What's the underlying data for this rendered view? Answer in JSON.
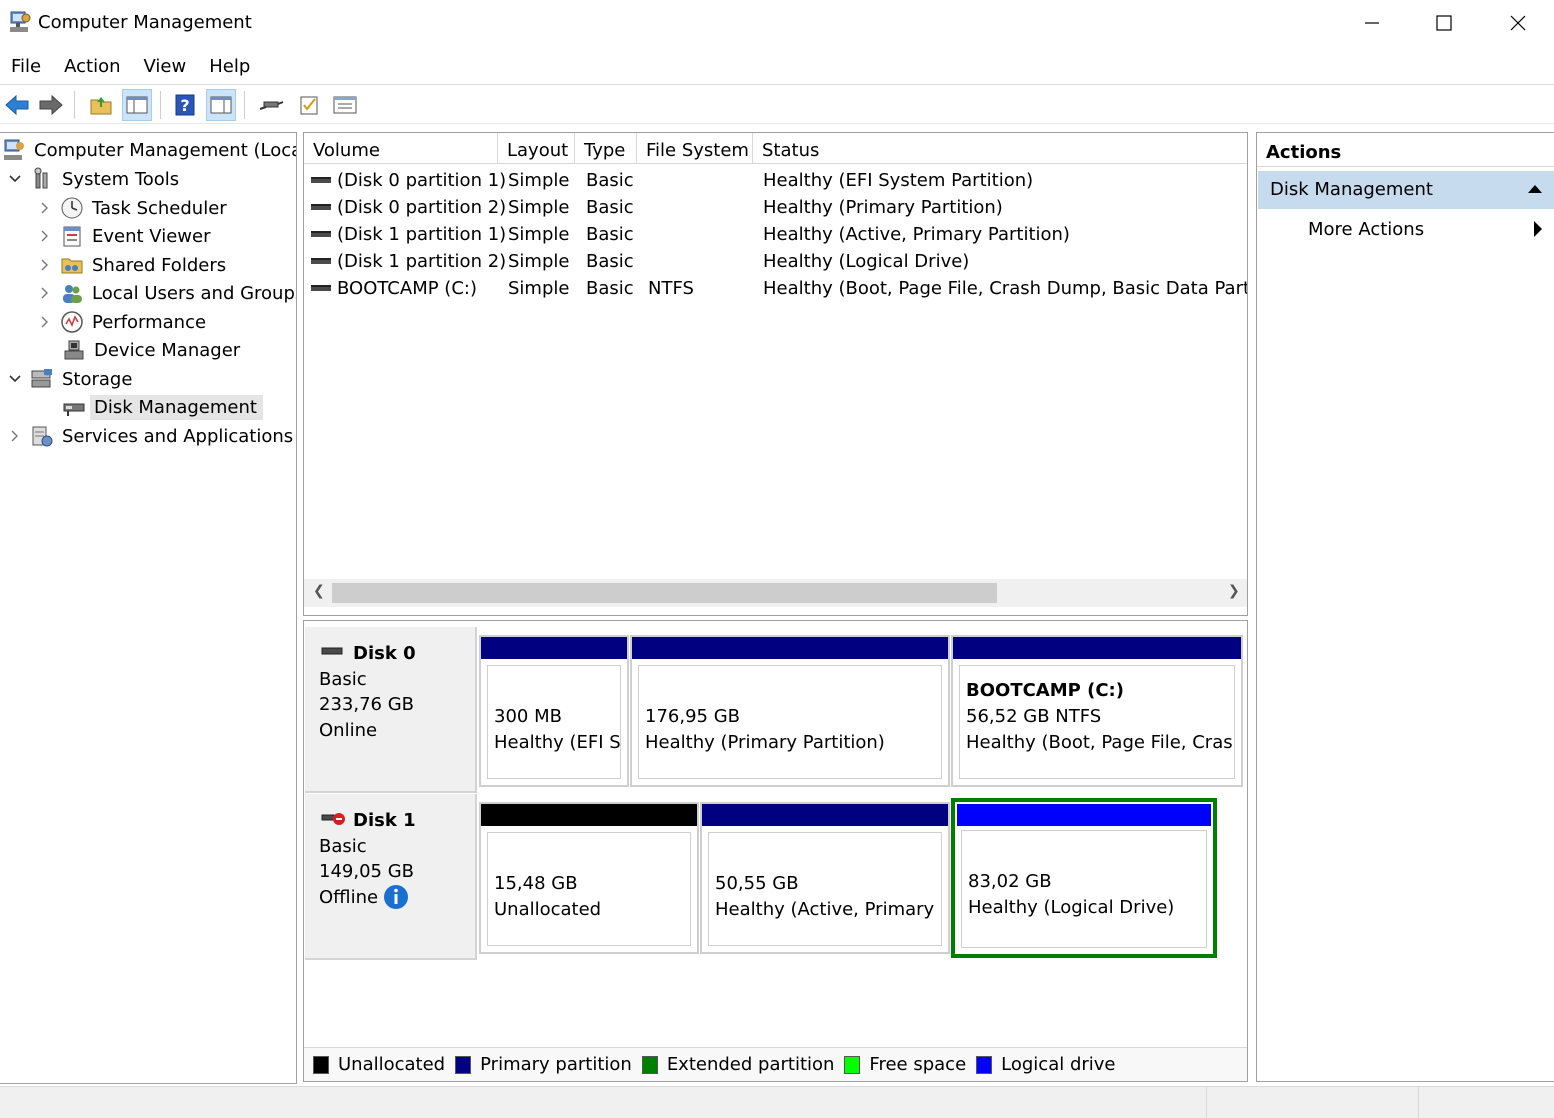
{
  "window": {
    "title": "Computer Management"
  },
  "menu": [
    "File",
    "Action",
    "View",
    "Help"
  ],
  "toolbar": {
    "icons": [
      "back-arrow-icon",
      "forward-arrow-icon",
      "up-folder-icon",
      "show-hide-tree-icon",
      "help-icon",
      "show-hide-action-icon",
      "connect-icon",
      "checklist-icon",
      "properties-icon"
    ]
  },
  "tree": {
    "root": "Computer Management (Local)",
    "system_tools": "System Tools",
    "task_scheduler": "Task Scheduler",
    "event_viewer": "Event Viewer",
    "shared_folders": "Shared Folders",
    "local_users": "Local Users and Groups",
    "performance": "Performance",
    "device_manager": "Device Manager",
    "storage": "Storage",
    "disk_management": "Disk Management",
    "services_apps": "Services and Applications"
  },
  "volumes": {
    "columns": [
      "Volume",
      "Layout",
      "Type",
      "File System",
      "Status"
    ],
    "rows": [
      {
        "volume": "(Disk 0 partition 1)",
        "layout": "Simple",
        "type": "Basic",
        "fs": "",
        "status": "Healthy (EFI System Partition)"
      },
      {
        "volume": "(Disk 0 partition 2)",
        "layout": "Simple",
        "type": "Basic",
        "fs": "",
        "status": "Healthy (Primary Partition)"
      },
      {
        "volume": "(Disk 1 partition 1)",
        "layout": "Simple",
        "type": "Basic",
        "fs": "",
        "status": "Healthy (Active, Primary Partition)"
      },
      {
        "volume": "(Disk 1 partition 2)",
        "layout": "Simple",
        "type": "Basic",
        "fs": "",
        "status": "Healthy (Logical Drive)"
      },
      {
        "volume": "BOOTCAMP (C:)",
        "layout": "Simple",
        "type": "Basic",
        "fs": "NTFS",
        "status": "Healthy (Boot, Page File, Crash Dump, Basic Data Partitior"
      }
    ]
  },
  "disks": {
    "disk0": {
      "name": "Disk 0",
      "type": "Basic",
      "size": "233,76 GB",
      "state": "Online",
      "partitions": [
        {
          "title": "",
          "line1": "300 MB",
          "line2": "Healthy (EFI Sy"
        },
        {
          "title": "",
          "line1": "176,95 GB",
          "line2": "Healthy (Primary Partition)"
        },
        {
          "title": "BOOTCAMP  (C:)",
          "line1": "56,52 GB NTFS",
          "line2": "Healthy (Boot, Page File, Crash I"
        }
      ]
    },
    "disk1": {
      "name": "Disk 1",
      "type": "Basic",
      "size": "149,05 GB",
      "state": "Offline",
      "partitions": [
        {
          "line1": "15,48 GB",
          "line2": "Unallocated"
        },
        {
          "line1": "50,55 GB",
          "line2": "Healthy (Active, Primary Pa"
        },
        {
          "line1": "83,02 GB",
          "line2": "Healthy (Logical Drive)"
        }
      ]
    }
  },
  "legend": [
    {
      "label": "Unallocated",
      "color": "#000000"
    },
    {
      "label": "Primary partition",
      "color": "#000080"
    },
    {
      "label": "Extended partition",
      "color": "#008000"
    },
    {
      "label": "Free space",
      "color": "#00ff00"
    },
    {
      "label": "Logical drive",
      "color": "#0000ff"
    }
  ],
  "actions": {
    "header": "Actions",
    "section": "Disk Management",
    "more": "More Actions"
  }
}
